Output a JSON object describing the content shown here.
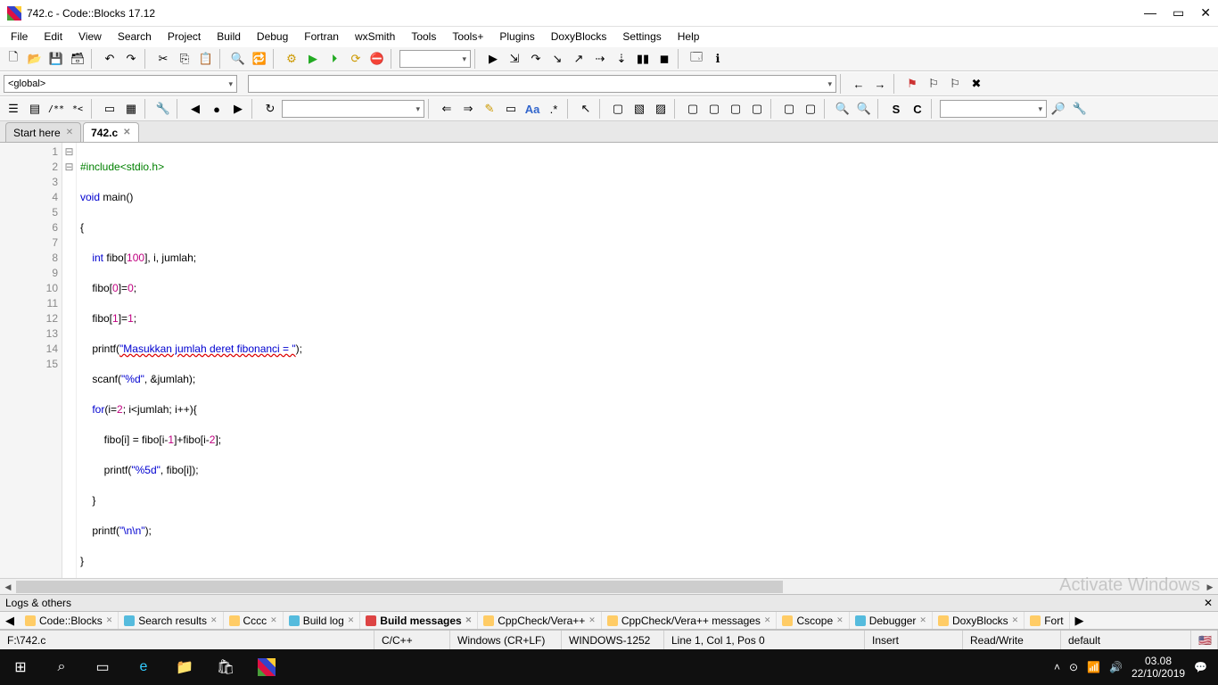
{
  "window": {
    "title": "742.c - Code::Blocks 17.12"
  },
  "menu": [
    "File",
    "Edit",
    "View",
    "Search",
    "Project",
    "Build",
    "Debug",
    "Fortran",
    "wxSmith",
    "Tools",
    "Tools+",
    "Plugins",
    "DoxyBlocks",
    "Settings",
    "Help"
  ],
  "scope_combo": "<global>",
  "tabs": [
    {
      "label": "Start here",
      "active": false
    },
    {
      "label": "742.c",
      "active": true
    }
  ],
  "code": {
    "lines": [
      1,
      2,
      3,
      4,
      5,
      6,
      7,
      8,
      9,
      10,
      11,
      12,
      13,
      14,
      15
    ],
    "fold": [
      "",
      "",
      "⊟",
      "",
      "",
      "",
      "",
      "",
      "⊟",
      "",
      "",
      "",
      "",
      "",
      ""
    ],
    "l1_pre": "#include<stdio.h>",
    "l2_kw1": "void",
    "l2_id": " main",
    "l2_p": "()",
    "l3": "{",
    "l4_kw": "int",
    "l4_rest": " fibo[",
    "l4_n": "100",
    "l4_rest2": "], i, jumlah;",
    "l5a": "    fibo[",
    "l5n": "0",
    "l5b": "]=",
    "l5n2": "0",
    "l5c": ";",
    "l6a": "    fibo[",
    "l6n": "1",
    "l6b": "]=",
    "l6n2": "1",
    "l6c": ";",
    "l7a": "    printf(",
    "l7s": "\"Masukkan jumlah deret fibonanci = \"",
    "l7b": ");",
    "l8a": "    scanf(",
    "l8s": "\"%d\"",
    "l8b": ", &jumlah);",
    "l9_kw": "for",
    "l9a": "(i=",
    "l9n": "2",
    "l9b": "; i<jumlah; i++){",
    "l10a": "        fibo[i] = fibo[i-",
    "l10n": "1",
    "l10b": "]+fibo[i-",
    "l10n2": "2",
    "l10c": "];",
    "l11a": "        printf(",
    "l11s": "\"%5d\"",
    "l11b": ", fibo[i]);",
    "l12": "    }",
    "l13a": "    printf(",
    "l13s": "\"\\n\\n\"",
    "l13b": ");",
    "l14": "}"
  },
  "logs": {
    "title": "Logs & others",
    "tabs": [
      "Code::Blocks",
      "Search results",
      "Cccc",
      "Build log",
      "Build messages",
      "CppCheck/Vera++",
      "CppCheck/Vera++ messages",
      "Cscope",
      "Debugger",
      "DoxyBlocks",
      "Fort"
    ],
    "active_idx": 4
  },
  "status": {
    "path": "F:\\742.c",
    "lang": "C/C++",
    "eol": "Windows (CR+LF)",
    "enc": "WINDOWS-1252",
    "pos": "Line 1, Col 1, Pos 0",
    "ins": "Insert",
    "rw": "Read/Write",
    "profile": "default"
  },
  "taskbar": {
    "time": "03.08",
    "date": "22/10/2019"
  },
  "watermark": "Activate Windows"
}
